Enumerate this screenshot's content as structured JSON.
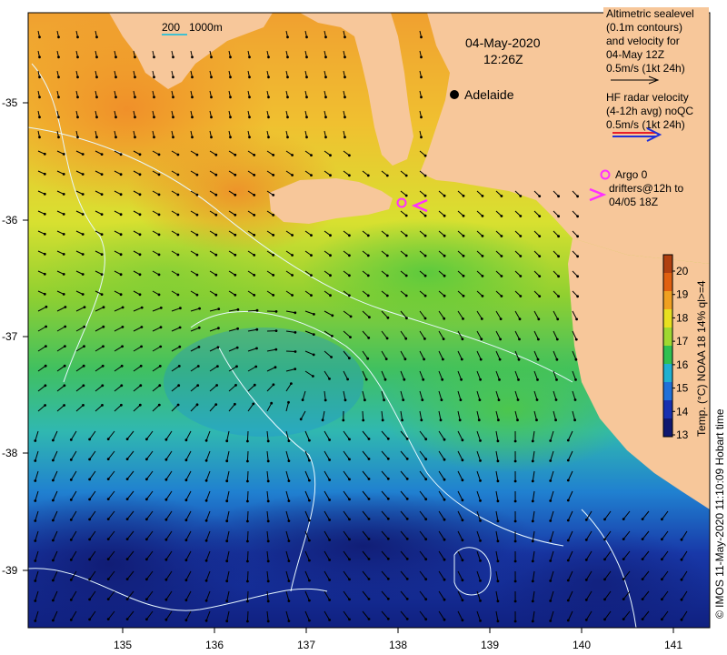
{
  "map": {
    "datetime": {
      "date": "04-May-2020",
      "time": "12:26Z"
    },
    "scale_bar": {
      "value_1": "200",
      "value_2": "1000m"
    },
    "city": {
      "name": "Adelaide"
    },
    "lon_ticks": [
      "135",
      "136",
      "137",
      "138",
      "139",
      "140",
      "141"
    ],
    "lat_ticks": [
      "-35",
      "-36",
      "-37",
      "-38",
      "-39"
    ],
    "legend": {
      "altimetry_lines": [
        "Altimetric sealevel",
        "(0.1m contours)",
        "and velocity for",
        "04-May 12Z",
        "0.5m/s (1kt 24h)"
      ],
      "hf_radar_lines": [
        "HF radar velocity",
        "(4-12h avg) noQC",
        "0.5m/s (1kt 24h)"
      ],
      "argo_label": "Argo 0",
      "drifter_lines": [
        "drifters@12h to",
        "04/05 18Z"
      ]
    },
    "colorbar": {
      "labels": [
        "20",
        "19",
        "18",
        "17",
        "16",
        "15",
        "14",
        "13"
      ],
      "title": "Temp. (°C) NOAA 18 14% ql>=4",
      "colors": [
        "#b04010",
        "#e06010",
        "#f0a020",
        "#e8e020",
        "#a0d830",
        "#30c050",
        "#20b0d0",
        "#2070d8",
        "#1830b0",
        "#101870"
      ]
    },
    "credit": "© IMOS 11-May-2020 11:10:09 Hobart time",
    "colors": {
      "land": "#f7c79a",
      "arrow": "#000000",
      "hf_radar_red": "#e8202a",
      "hf_radar_blue": "#2030d8",
      "argo_magenta": "#ff30ff",
      "contour": "#e8f8ff"
    }
  }
}
